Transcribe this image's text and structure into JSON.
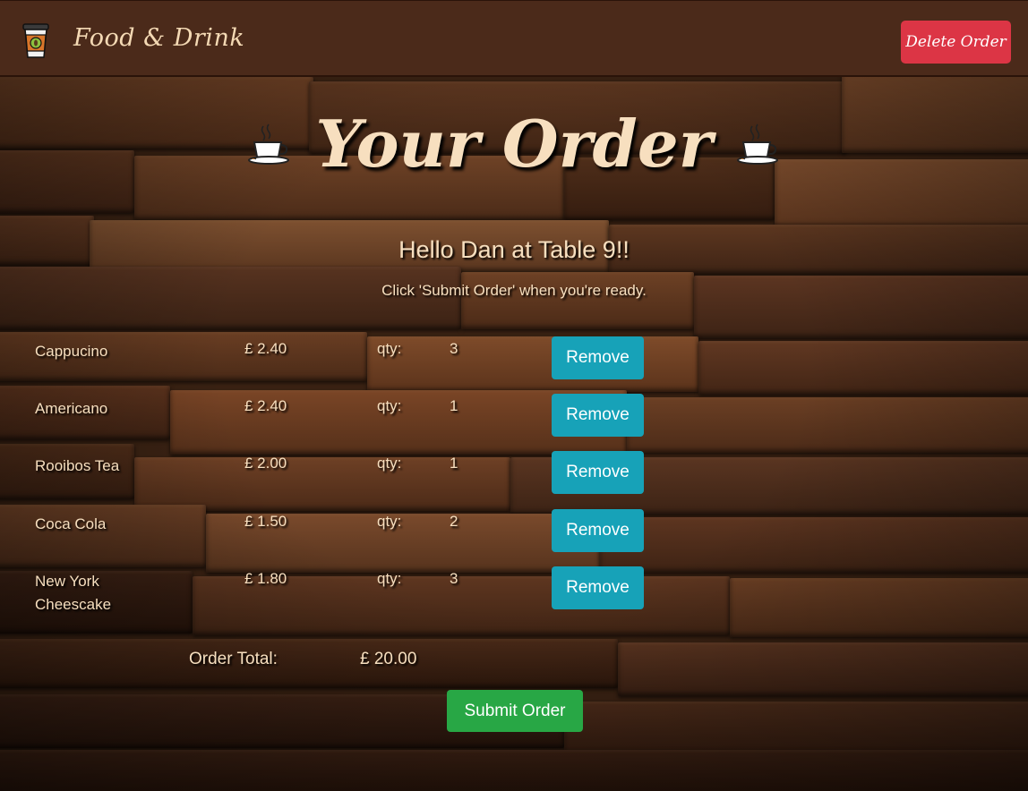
{
  "navbar": {
    "brand_name": "Food & Drink",
    "delete_label": "Delete Order"
  },
  "header": {
    "title": "Your Order",
    "greeting": "Hello Dan at Table 9!!",
    "hint": "Click 'Submit Order' when you're ready."
  },
  "order": {
    "items": [
      {
        "name": "Cappucino",
        "price": "£ 2.40",
        "qty_label": "qty:",
        "qty": "3",
        "remove_label": "Remove"
      },
      {
        "name": "Americano",
        "price": "£ 2.40",
        "qty_label": "qty:",
        "qty": "1",
        "remove_label": "Remove"
      },
      {
        "name": "Rooibos Tea",
        "price": "£ 2.00",
        "qty_label": "qty:",
        "qty": "1",
        "remove_label": "Remove"
      },
      {
        "name": "Coca Cola",
        "price": "£ 1.50",
        "qty_label": "qty:",
        "qty": "2",
        "remove_label": "Remove"
      },
      {
        "name": "New York Cheescake",
        "price": "£ 1.80",
        "qty_label": "qty:",
        "qty": "3",
        "remove_label": "Remove"
      }
    ],
    "total_label": "Order Total:",
    "total_value": "£ 20.00",
    "submit_label": "Submit Order"
  },
  "icons": {
    "brand": "coffee-cup-icon",
    "title_left": "teacup-icon",
    "title_right": "teacup-icon"
  },
  "colors": {
    "navbar": "#4b2a1a",
    "accent_text": "#f7dfbf",
    "delete": "#dc3545",
    "remove": "#17a2b8",
    "submit": "#28a745"
  }
}
